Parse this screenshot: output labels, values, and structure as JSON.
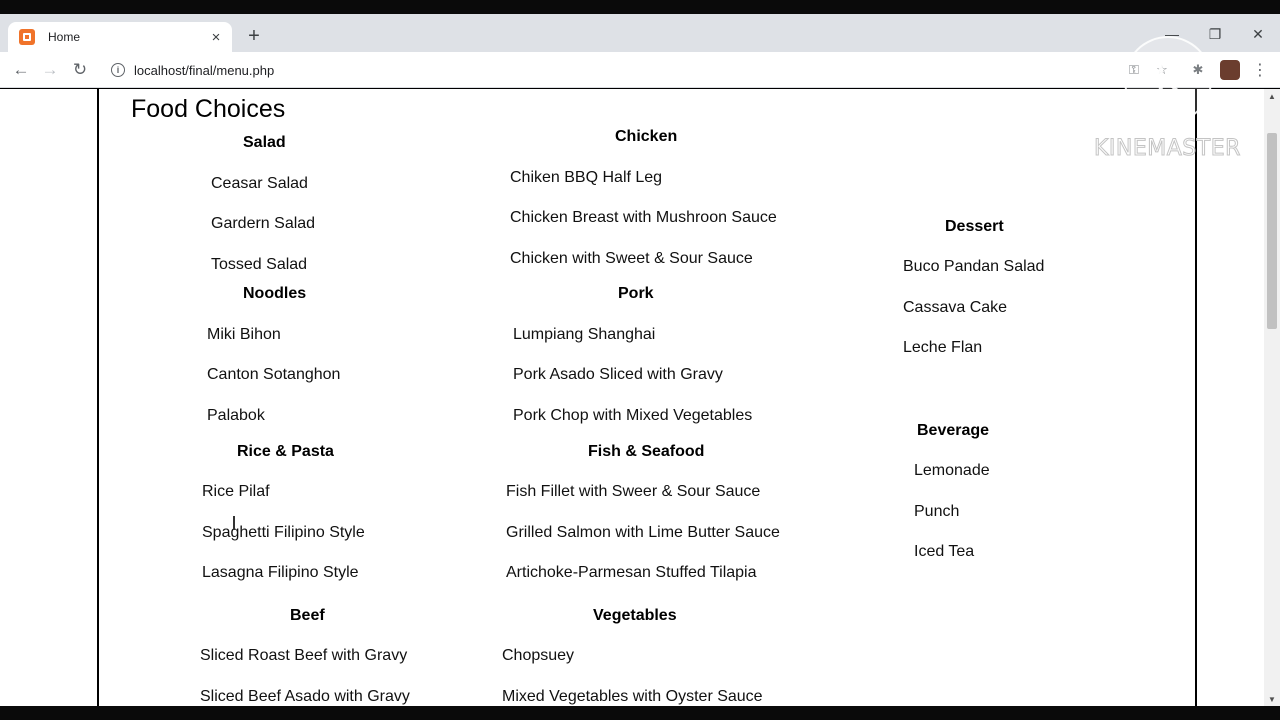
{
  "browser": {
    "tab_title": "Home",
    "tab_close": "×",
    "new_tab": "+",
    "url": "localhost/final/menu.php",
    "info_glyph": "i",
    "window_minimize": "—",
    "window_restore": "❐",
    "window_close": "✕",
    "back": "←",
    "forward": "→",
    "reload": "↻",
    "menu": "⋮"
  },
  "page": {
    "title": "Food Choices",
    "sections": [
      {
        "heading": "Salad",
        "items": [
          "Ceasar Salad",
          "Gardern Salad",
          "Tossed Salad"
        ]
      },
      {
        "heading": "Noodles",
        "items": [
          "Miki Bihon",
          "Canton Sotanghon",
          "Palabok"
        ]
      },
      {
        "heading": "Rice & Pasta",
        "items": [
          "Rice Pilaf",
          "Spaghetti Filipino Style",
          "Lasagna Filipino Style"
        ]
      },
      {
        "heading": "Beef",
        "items": [
          "Sliced Roast Beef with Gravy",
          "Sliced Beef Asado with Gravy"
        ]
      },
      {
        "heading": "Chicken",
        "items": [
          "Chiken BBQ Half Leg",
          "Chicken Breast with Mushroon Sauce",
          "Chicken with Sweet & Sour Sauce"
        ]
      },
      {
        "heading": "Pork",
        "items": [
          "Lumpiang Shanghai",
          "Pork Asado Sliced with Gravy",
          "Pork Chop with Mixed Vegetables"
        ]
      },
      {
        "heading": "Fish & Seafood",
        "items": [
          "Fish Fillet with Sweer & Sour Sauce",
          "Grilled Salmon with Lime Butter Sauce",
          "Artichoke-Parmesan Stuffed Tilapia"
        ]
      },
      {
        "heading": "Vegetables",
        "items": [
          "Chopsuey",
          "Mixed Vegetables with Oyster Sauce"
        ]
      },
      {
        "heading": "Dessert",
        "items": [
          "Buco Pandan Salad",
          "Cassava Cake",
          "Leche Flan"
        ]
      },
      {
        "heading": "Beverage",
        "items": [
          "Lemonade",
          "Punch",
          "Iced Tea"
        ]
      }
    ]
  },
  "watermark": {
    "logo_letter": "K",
    "text": "KINEMASTER"
  },
  "colors": {
    "tab_favicon": "#f0732a",
    "tabstrip": "#dee1e6"
  }
}
